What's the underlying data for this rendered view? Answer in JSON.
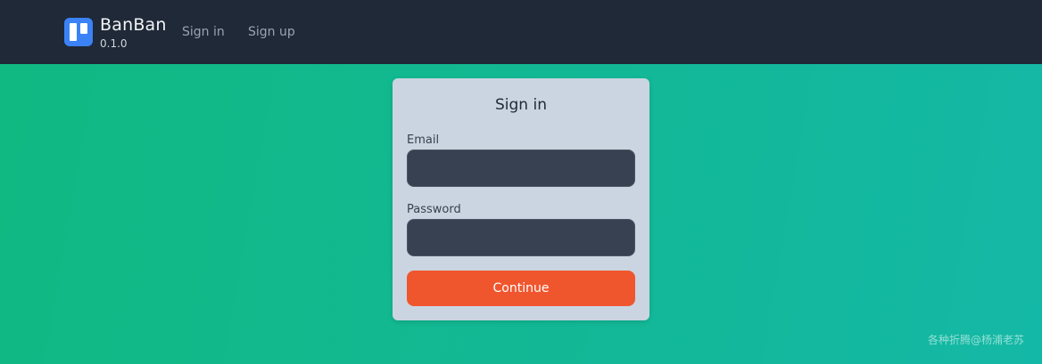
{
  "header": {
    "brand_name": "BanBan",
    "version": "0.1.0",
    "nav": [
      {
        "label": "Sign in"
      },
      {
        "label": "Sign up"
      }
    ]
  },
  "form": {
    "title": "Sign in",
    "email_label": "Email",
    "email_value": "",
    "password_label": "Password",
    "password_value": "",
    "submit_label": "Continue"
  },
  "watermark": "各种折腾@杨浦老苏",
  "colors": {
    "topbar": "#1f2937",
    "logo": "#3b82f6",
    "background_start": "#10b981",
    "background_end": "#14b8a6",
    "card": "#cbd5e1",
    "input": "#374151",
    "button": "#f0562e"
  },
  "icons": {
    "logo": "kanban-board-icon"
  }
}
